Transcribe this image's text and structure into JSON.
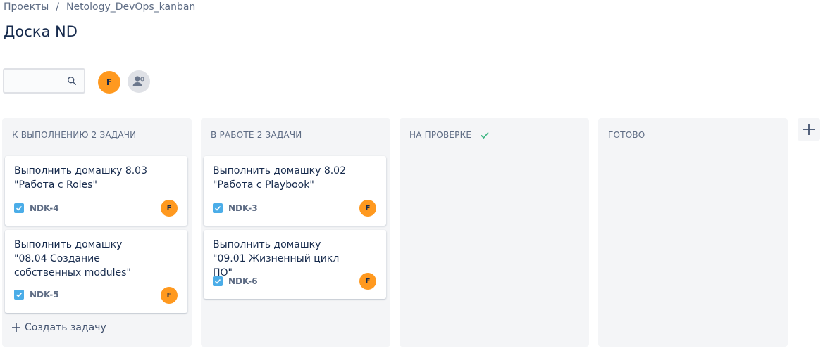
{
  "breadcrumb": {
    "project": "Проекты",
    "separator": "/",
    "board": "Netology_DevOps_kanban"
  },
  "page": {
    "title": "Доска ND"
  },
  "search": {
    "value": "",
    "placeholder": ""
  },
  "members": {
    "main_avatar_initial": "F"
  },
  "colors": {
    "accent_avatar": "#ff991f",
    "task_icon": "#4bade8",
    "column_bg": "#f4f5f7",
    "done_check": "#36b37e"
  },
  "columns": [
    {
      "title": "К ВЫПОЛНЕНИЮ 2 ЗАДАЧИ",
      "cards": [
        {
          "title": "Выполнить домашку 8.03 \"Работа с Roles\"",
          "key": "NDK-4",
          "assignee": "F"
        },
        {
          "title": "Выполнить домашку \"08.04 Создание собственных modules\"",
          "key": "NDK-5",
          "assignee": "F"
        }
      ],
      "create_label": "Создать задачу"
    },
    {
      "title": "В РАБОТЕ 2 ЗАДАЧИ",
      "cards": [
        {
          "title": "Выполнить домашку 8.02 \"Работа с Playbook\"",
          "key": "NDK-3",
          "assignee": "F"
        },
        {
          "title": "Выполнить домашку \"09.01 Жизненный цикл ПО\"",
          "key": "NDK-6",
          "assignee": "F"
        }
      ]
    },
    {
      "title": "НА ПРОВЕРКЕ",
      "done_icon": "check-icon",
      "cards": []
    },
    {
      "title": "ГОТОВО",
      "cards": []
    }
  ],
  "icons": {
    "search": "search-icon",
    "add_member": "add-person-icon",
    "add_column": "plus-icon",
    "create": "plus-icon",
    "task_type": "checkbox-task-icon"
  }
}
